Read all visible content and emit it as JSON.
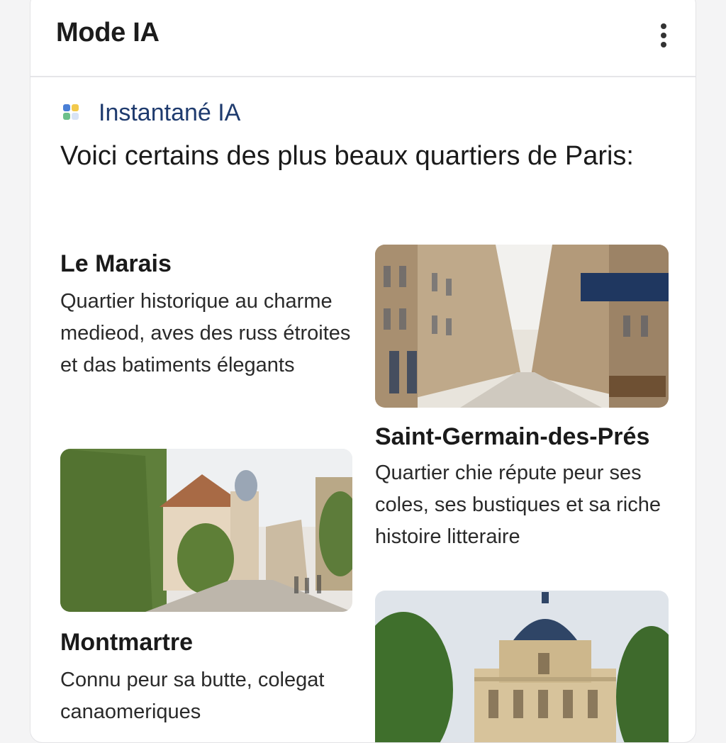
{
  "header": {
    "title": "Mode IA",
    "menu_icon": "more-vert-icon"
  },
  "snapshot": {
    "label": "Instantané IA",
    "icon": "ai-snapshot-icon"
  },
  "intro": "Voici certains des plus beaux quartiers de Paris:",
  "places": [
    {
      "name": "Le Marais",
      "description": "Quartier historique au charme medieod, aves des russ étroites et das batiments élegants",
      "image": "paris-street-photo"
    },
    {
      "name": "Saint-Germain-des-Prés",
      "description": "Quartier chie répute peur ses coles, ses bustiques et sa riche histoire litteraire",
      "image": "ivy-street-photo"
    },
    {
      "name": "Montmartre",
      "description": "Connu peur sa butte, colegat canaomeriques",
      "image": "domed-palace-photo"
    }
  ],
  "colors": {
    "accent_text": "#1f3b6e",
    "card_bg": "#ffffff",
    "page_bg": "#f4f4f5"
  }
}
